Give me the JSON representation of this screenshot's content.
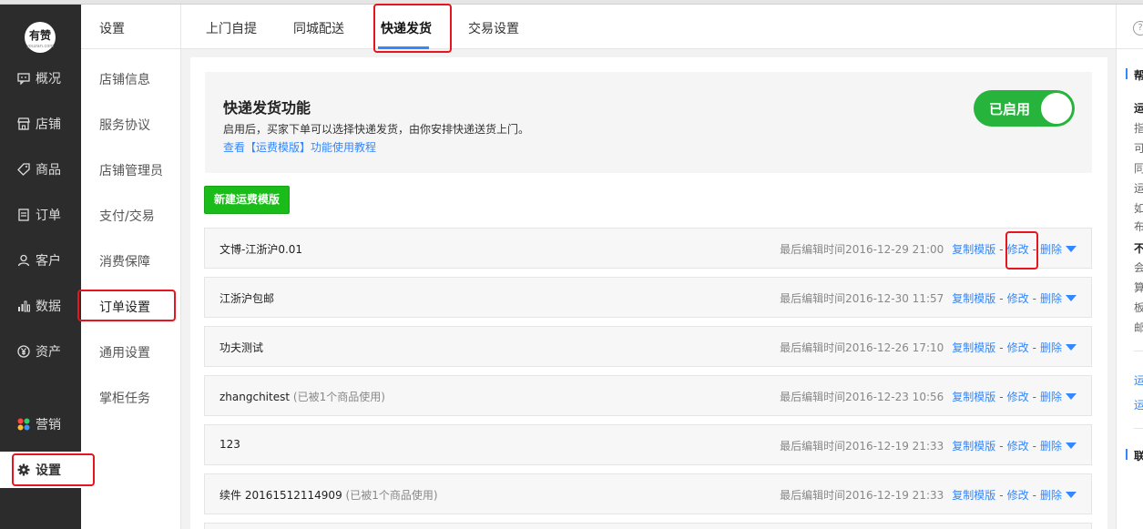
{
  "logo": {
    "text": "有赞",
    "sub": "youzan.com"
  },
  "leftnav": [
    {
      "label": "概况",
      "icon": "chat-bubble-icon"
    },
    {
      "label": "店铺",
      "icon": "store-icon"
    },
    {
      "label": "商品",
      "icon": "tag-icon"
    },
    {
      "label": "订单",
      "icon": "list-icon"
    },
    {
      "label": "客户",
      "icon": "person-icon"
    },
    {
      "label": "数据",
      "icon": "bar-chart-icon"
    },
    {
      "label": "资产",
      "icon": "yen-icon"
    },
    {
      "label": "营销",
      "icon": "grid-colorful-icon"
    },
    {
      "label": "设置",
      "icon": "gear-icon"
    }
  ],
  "subnav": {
    "title": "设置",
    "items": [
      "店铺信息",
      "服务协议",
      "店铺管理员",
      "支付/交易",
      "消费保障",
      "订单设置",
      "通用设置",
      "掌柜任务"
    ]
  },
  "tabs": [
    "上门自提",
    "同城配送",
    "快递发货",
    "交易设置"
  ],
  "feature": {
    "title": "快递发货功能",
    "desc": "启用后，买家下单可以选择快递发货，由你安排快递送货上门。",
    "link": "查看【运费模版】功能使用教程",
    "toggle_label": "已启用"
  },
  "new_button": "新建运费模版",
  "row_actions": {
    "copy": "复制模版",
    "edit": "修改",
    "delete": "删除",
    "sep": "-"
  },
  "templates": [
    {
      "name": "文博-江浙沪0.01",
      "usage": "",
      "time": "最后编辑时间2016-12-29 21:00"
    },
    {
      "name": "江浙沪包邮",
      "usage": "",
      "time": "最后编辑时间2016-12-30 11:57"
    },
    {
      "name": "功夫测试",
      "usage": "",
      "time": "最后编辑时间2016-12-26 17:10"
    },
    {
      "name": "zhangchitest",
      "usage": "(已被1个商品使用)",
      "time": "最后编辑时间2016-12-23 10:56"
    },
    {
      "name": "123",
      "usage": "",
      "time": "最后编辑时间2016-12-19 21:33"
    },
    {
      "name": "续件 20161512114909",
      "usage": "(已被1个商品使用)",
      "time": "最后编辑时间2016-12-19 21:33"
    }
  ],
  "help": {
    "q": "?",
    "title1": "帮",
    "lines": [
      "运",
      "指",
      "可",
      "同",
      "运",
      "如",
      "布"
    ],
    "bold2": "不",
    "lines2": [
      "会",
      "算",
      "板",
      "邮"
    ],
    "links": [
      "运",
      "运"
    ],
    "title2": "联"
  }
}
